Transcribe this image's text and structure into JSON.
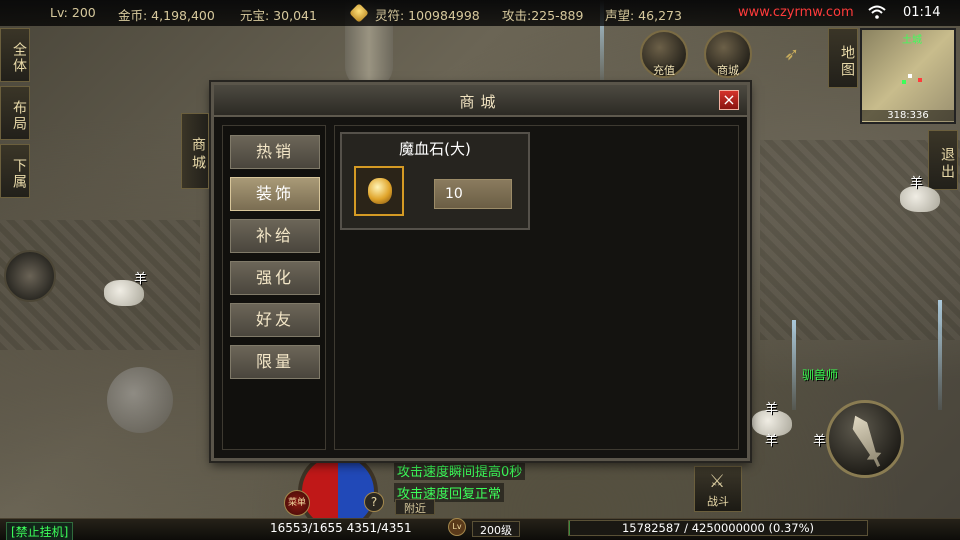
{
  "topbar": {
    "level": "Lv: 200",
    "gold": "金币: 4,198,400",
    "yuanbao": "元宝: 30,041",
    "lingfu": "灵符: 100984998",
    "attack": "攻击:225-889",
    "prestige": "声望: 46,273",
    "site": "www.czyrmw.com",
    "clock": "01:14"
  },
  "left_tabs": [
    "全体",
    "布局",
    "下属"
  ],
  "top_right": {
    "recharge_label": "充值",
    "mall_label": "商城",
    "map_label": "地图",
    "exit_label": "退出",
    "minimap_name": "土城",
    "minimap_coords": "318:336"
  },
  "world_labels": {
    "sheep": "羊",
    "player_name": "驯兽师"
  },
  "shop": {
    "title": "商城",
    "side_tab": "商城",
    "close": "×",
    "categories": [
      "热销",
      "装饰",
      "补给",
      "强化",
      "好友",
      "限量"
    ],
    "active_category": "装饰",
    "item": {
      "name": "魔血石(大)",
      "icon": "blood-stone-icon",
      "price": "10"
    }
  },
  "chat": {
    "line1": "攻击速度瞬间提高0秒",
    "line2": "攻击速度回复正常",
    "near_tab": "附近"
  },
  "hud": {
    "menu_label": "菜单",
    "help": "?",
    "battle_label": "战斗"
  },
  "bottombar": {
    "no_afk": "[禁止挂机]",
    "hp_mp": "16553/1655 4351/4351",
    "lv_icon": "Lv",
    "level_text": "200级",
    "exp_text": "15782587 / 4250000000 (0.37%)",
    "exp_fraction": 0.0037
  },
  "colors": {
    "accent_gold": "#d49a24",
    "chat_green": "#3cff5a",
    "site_red": "#ff3b3b",
    "close_red": "#d4322a"
  }
}
